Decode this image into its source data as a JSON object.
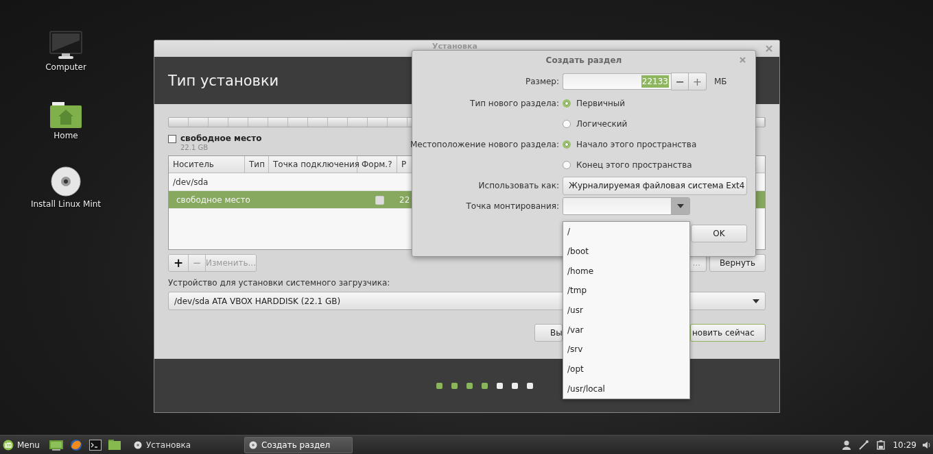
{
  "desktop_icons": [
    {
      "label": "Computer",
      "kind": "computer"
    },
    {
      "label": "Home",
      "kind": "home"
    },
    {
      "label": "Install Linux Mint",
      "kind": "disc"
    }
  ],
  "installer": {
    "title": "Установка",
    "heading": "Тип установки",
    "legend": {
      "label": "свободное место",
      "size": "22.1 GB",
      "checked": false
    },
    "table": {
      "columns": [
        "Носитель",
        "Тип",
        "Точка подключения",
        "Форм.?",
        "Р"
      ],
      "rows": [
        {
          "kind": "disk",
          "device": "/dev/sda",
          "selected": false
        },
        {
          "kind": "partition",
          "device": "свободное место",
          "selected": true,
          "format_checked": false,
          "size": "22"
        }
      ]
    },
    "tool_buttons": [
      {
        "label": "+",
        "disabled": false
      },
      {
        "label": "−",
        "disabled": true
      },
      {
        "label": "Изменить...",
        "disabled": true
      }
    ],
    "new_table_button": "...",
    "revert_button": "Вернуть",
    "bootloader_label": "Устройство для установки системного загрузчика:",
    "bootloader_device": "/dev/sda ATA VBOX HARDDISK (22.1 GB)",
    "quit_button": "Вы",
    "install_button": "новить сейчас",
    "steps": [
      {
        "done": true
      },
      {
        "done": true
      },
      {
        "done": true
      },
      {
        "done": true
      },
      {
        "done": false
      },
      {
        "done": false
      },
      {
        "done": false
      }
    ]
  },
  "dialog": {
    "title": "Создать раздел",
    "size": {
      "label": "Размер:",
      "value": "22133",
      "value_selected": true,
      "minus": "−",
      "plus": "+",
      "unit": "МБ"
    },
    "type": {
      "label": "Тип нового раздела:",
      "options": [
        {
          "label": "Первичный",
          "selected": true
        },
        {
          "label": "Логический",
          "selected": false
        }
      ]
    },
    "location": {
      "label": "Местоположение нового раздела:",
      "options": [
        {
          "label": "Начало этого пространства",
          "selected": true
        },
        {
          "label": "Конец этого пространства",
          "selected": false
        }
      ]
    },
    "use_as": {
      "label": "Использовать как:",
      "value": "Журналируемая файловая система Ext4"
    },
    "mount_point": {
      "label": "Точка монтирования:",
      "expanded": true,
      "options": [
        "/",
        "/boot",
        "/home",
        "/tmp",
        "/usr",
        "/var",
        "/srv",
        "/opt",
        "/usr/local"
      ]
    },
    "ok_button": "OK"
  },
  "taskbar": {
    "menu": "Menu",
    "windows": [
      {
        "label": "Установка",
        "selected": false
      },
      {
        "label": "Создать раздел",
        "selected": true
      }
    ],
    "clock": "10:29"
  }
}
